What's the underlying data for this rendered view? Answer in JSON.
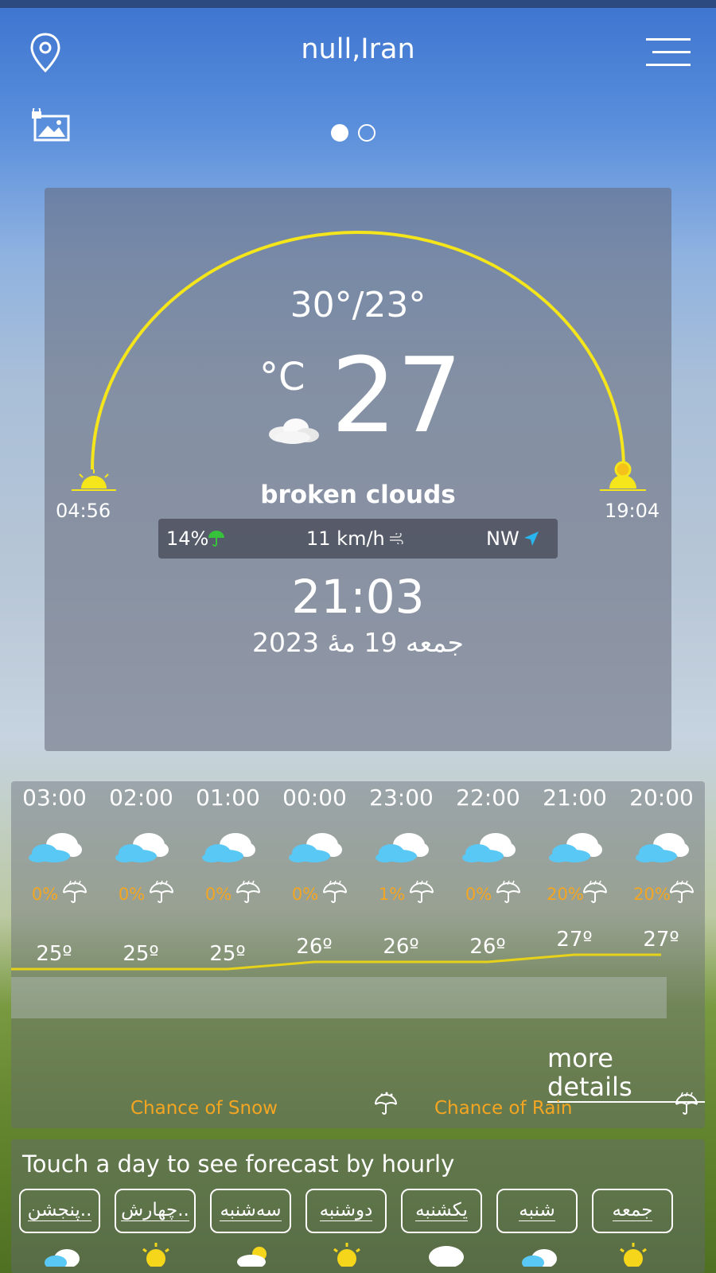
{
  "header": {
    "location_icon": "map-pin-icon",
    "city": "null,Iran",
    "menu_icon": "hamburger-menu-icon",
    "wallpaper_icon": "locked-image-icon",
    "pages": 2,
    "active_page": 1
  },
  "current": {
    "hi_lo": "30°/23°",
    "unit": "°C",
    "temp": "27",
    "condition_icon": "broken-clouds-icon",
    "condition": "broken clouds",
    "sunrise": "04:56",
    "sunset": "19:04",
    "precip": "14%",
    "precip_icon": "umbrella-icon",
    "wind_speed": "11 km/h",
    "wind_icon": "wind-icon",
    "wind_dir": "NW",
    "wind_dir_icon": "navigation-arrow-icon",
    "time": "21:03",
    "date": "جمعه 19 مۀ 2023",
    "sun_progress": 0.83
  },
  "hourly": [
    {
      "time": "03:00",
      "pop": "0%",
      "temp": "25º",
      "temp_value": 25
    },
    {
      "time": "02:00",
      "pop": "0%",
      "temp": "25º",
      "temp_value": 25
    },
    {
      "time": "01:00",
      "pop": "0%",
      "temp": "25º",
      "temp_value": 25
    },
    {
      "time": "00:00",
      "pop": "0%",
      "temp": "26º",
      "temp_value": 26
    },
    {
      "time": "23:00",
      "pop": "1%",
      "temp": "26º",
      "temp_value": 26
    },
    {
      "time": "22:00",
      "pop": "0%",
      "temp": "26º",
      "temp_value": 26
    },
    {
      "time": "21:00",
      "pop": "20%",
      "temp": "27º",
      "temp_value": 27
    },
    {
      "time": "20:00",
      "pop": "20%",
      "temp": "27º",
      "temp_value": 27
    }
  ],
  "hourly_footer": {
    "more_details": "more details",
    "chance_snow": "Chance of Snow",
    "chance_rain": "Chance of Rain"
  },
  "daily": {
    "hint": "Touch a day to see forecast by hourly",
    "days": [
      {
        "label": "پنجشن..",
        "icon": "partly-cloudy-icon"
      },
      {
        "label": "چهارش..",
        "icon": "sun-icon"
      },
      {
        "label": "سه‌شنبه",
        "icon": "partly-sunny-icon"
      },
      {
        "label": "دوشنبه",
        "icon": "sun-icon"
      },
      {
        "label": "یکشنبه",
        "icon": "cloud-icon"
      },
      {
        "label": "شنبه",
        "icon": "partly-cloudy-icon"
      },
      {
        "label": "جمعه",
        "icon": "sun-icon"
      }
    ]
  },
  "colors": {
    "arc": "#f5e51b",
    "accent_orange": "#f4a622",
    "panel": "#646878"
  }
}
